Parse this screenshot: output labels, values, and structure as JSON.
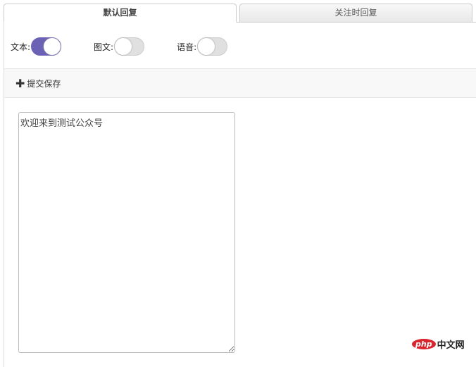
{
  "tabs": [
    {
      "label": "默认回复",
      "active": true
    },
    {
      "label": "关注时回复",
      "active": false
    }
  ],
  "toggles": [
    {
      "label": "文本:",
      "on": true
    },
    {
      "label": "图文:",
      "on": false
    },
    {
      "label": "语音:",
      "on": false
    }
  ],
  "toolbar": {
    "save_label": "提交保存",
    "icon": "plus-icon"
  },
  "editor": {
    "value": "欢迎来到测试公众号"
  },
  "watermark": {
    "php": "php",
    "text": "中文网"
  },
  "colors": {
    "accent": "#6b62b5"
  }
}
